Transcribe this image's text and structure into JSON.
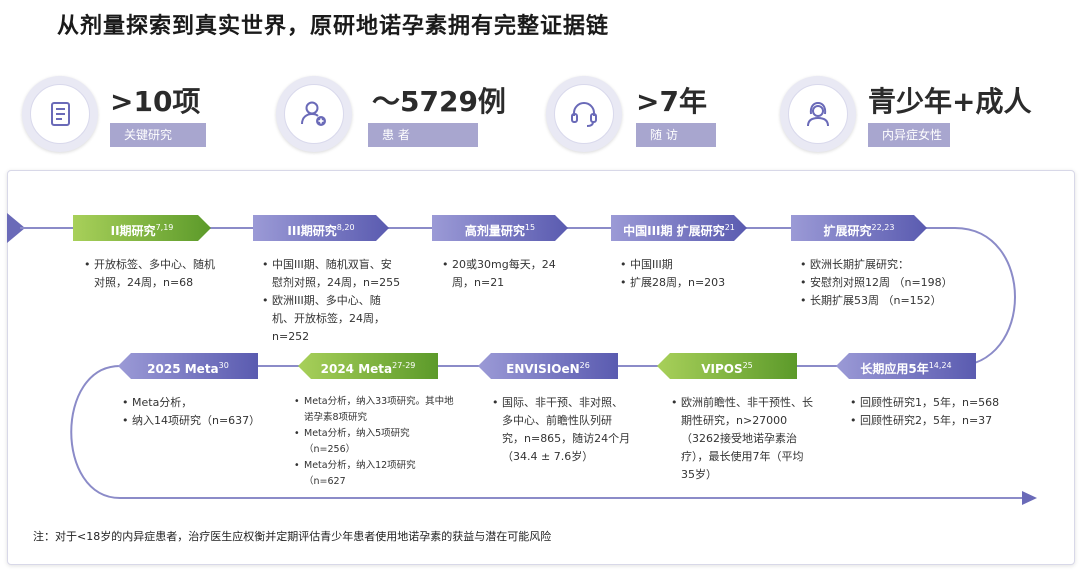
{
  "title": "从剂量探索到真实世界，原研地诺孕素拥有完整证据链",
  "stats": [
    {
      "value": ">10项",
      "label": "关键研究",
      "icon": "document-icon"
    },
    {
      "value": "～5729例",
      "label": "患 者",
      "icon": "patient-add-icon"
    },
    {
      "value": ">7年",
      "label": "随 访",
      "icon": "headset-icon"
    },
    {
      "value": "青少年+成人",
      "label": "内异症女性",
      "icon": "woman-icon"
    }
  ],
  "timeline": {
    "row1": [
      {
        "label": "II期研究",
        "sup": "7,19",
        "color": "green",
        "bullets": [
          "开放标签、多中心、随机对照，24周，n=68"
        ]
      },
      {
        "label": "III期研究",
        "sup": "8,20",
        "color": "blue",
        "bullets": [
          "中国III期、随机双盲、安慰剂对照，24周，n=255",
          "欧洲III期、多中心、随机、开放标签，24周，n=252"
        ]
      },
      {
        "label": "高剂量研究",
        "sup": "15",
        "color": "blue",
        "bullets": [
          "20或30mg每天，24周，n=21"
        ]
      },
      {
        "label": "中国III期 扩展研究",
        "sup": "21",
        "color": "blue",
        "bullets": [
          "中国III期",
          "扩展28周，n=203"
        ]
      },
      {
        "label": "扩展研究",
        "sup": "22,23",
        "color": "blue",
        "bullets": [
          "欧洲长期扩展研究：",
          "安慰剂对照12周 （n=198）",
          "长期扩展53周 （n=152）"
        ]
      }
    ],
    "row2": [
      {
        "label": "2025 Meta",
        "sup": "30",
        "color": "blue",
        "bullets": [
          "Meta分析，",
          "纳入14项研究（n=637）"
        ]
      },
      {
        "label": "2024 Meta",
        "sup": "27-29",
        "color": "green",
        "bullets": [
          "Meta分析，纳入33项研究。其中地诺孕素8项研究",
          "Meta分析，纳入5项研究（n=256）",
          "Meta分析，纳入12项研究（n=627"
        ]
      },
      {
        "label": "ENVISIOeN",
        "sup": "26",
        "color": "blue",
        "bullets": [
          "国际、非干预、非对照、多中心、前瞻性队列研究，n=865，随访24个月（34.4 ± 7.6岁）"
        ]
      },
      {
        "label": "VIPOS",
        "sup": "25",
        "color": "green",
        "bullets": [
          "欧洲前瞻性、非干预性、长期性研究，n>27000 （3262接受地诺孕素治疗），最长使用7年（平均35岁）"
        ]
      },
      {
        "label": "长期应用5年",
        "sup": "14,24",
        "color": "blue",
        "bullets": [
          "回顾性研究1，5年，n=568",
          "回顾性研究2，5年，n=37"
        ]
      }
    ]
  },
  "note": "注：对于<18岁的内异症患者，治疗医生应权衡并定期评估青少年患者使用地诺孕素的获益与潜在可能风险",
  "colors": {
    "accent": "#5a5bb0",
    "green": "#6aa532",
    "tag": "#a8a6cf",
    "line": "#7f7fc4"
  }
}
